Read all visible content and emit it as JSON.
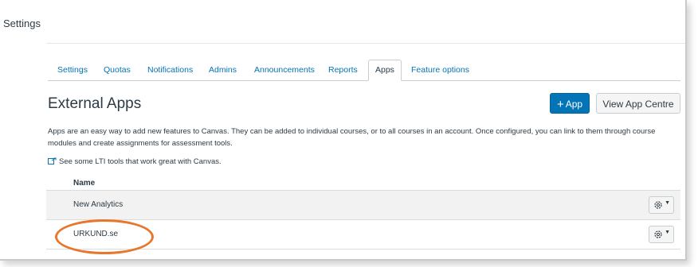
{
  "page": {
    "title": "Settings"
  },
  "tabs": [
    {
      "label": "Settings",
      "active": false
    },
    {
      "label": "Quotas",
      "active": false
    },
    {
      "label": "Notifications",
      "active": false
    },
    {
      "label": "Admins",
      "active": false
    },
    {
      "label": "Announcements",
      "active": false
    },
    {
      "label": "Reports",
      "active": false
    },
    {
      "label": "Apps",
      "active": true
    },
    {
      "label": "Feature options",
      "active": false
    }
  ],
  "external_apps": {
    "heading": "External Apps",
    "add_button": {
      "icon": "plus-icon",
      "label": "App"
    },
    "view_button": "View App Centre",
    "description": "Apps are an easy way to add new features to Canvas. They can be added to individual courses, or to all courses in an account. Once configured, you can link to them through course modules and create assignments for assessment tools.",
    "lti_link": {
      "icon": "external-link-icon",
      "label": "See some LTI tools that work great with Canvas."
    },
    "table": {
      "column_header": "Name",
      "rows": [
        {
          "name": "New Analytics",
          "action_icon": "gear-icon"
        },
        {
          "name": "URKUND.se",
          "action_icon": "gear-icon"
        }
      ]
    }
  },
  "colors": {
    "link": "#0374b5",
    "primary_button": "#0374b5",
    "text": "#2d3b45",
    "highlight_annotation": "#e8762b"
  }
}
